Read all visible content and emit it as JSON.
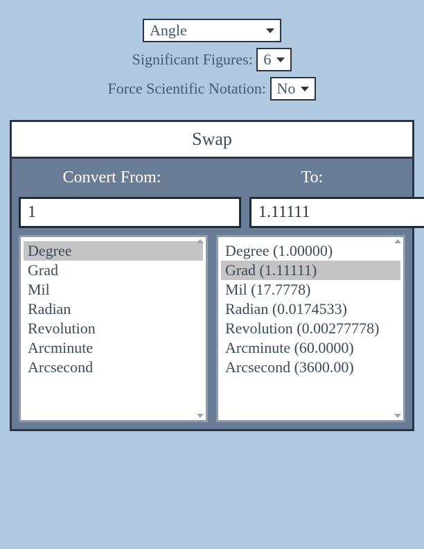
{
  "top": {
    "category": "Angle",
    "sigfig_label": "Significant Figures:",
    "sigfig_value": "6",
    "scinot_label": "Force Scientific Notation:",
    "scinot_value": "No"
  },
  "converter": {
    "swap_label": "Swap",
    "from_header": "Convert From:",
    "to_header": "To:",
    "from_value": "1",
    "to_value": "1.11111",
    "from_units": [
      {
        "label": "Degree",
        "selected": true
      },
      {
        "label": "Grad",
        "selected": false
      },
      {
        "label": "Mil",
        "selected": false
      },
      {
        "label": "Radian",
        "selected": false
      },
      {
        "label": "Revolution",
        "selected": false
      },
      {
        "label": "Arcminute",
        "selected": false
      },
      {
        "label": "Arcsecond",
        "selected": false
      }
    ],
    "to_units": [
      {
        "label": "Degree (1.00000)",
        "selected": false
      },
      {
        "label": "Grad (1.11111)",
        "selected": true
      },
      {
        "label": "Mil (17.7778)",
        "selected": false
      },
      {
        "label": "Radian (0.0174533)",
        "selected": false
      },
      {
        "label": "Revolution (0.00277778)",
        "selected": false
      },
      {
        "label": "Arcminute (60.0000)",
        "selected": false
      },
      {
        "label": "Arcsecond (3600.00)",
        "selected": false
      }
    ]
  }
}
